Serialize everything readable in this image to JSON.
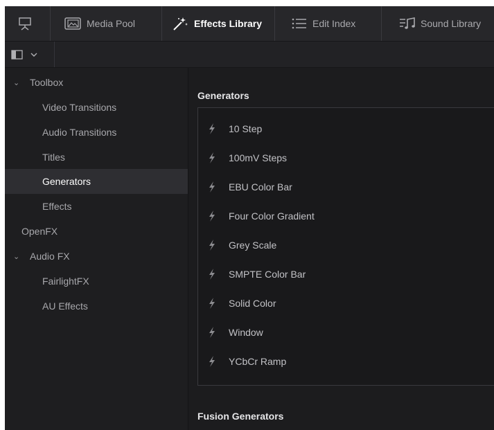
{
  "toolbar": {
    "tabs": [
      {
        "label": "Media Pool",
        "icon": "media-pool-icon"
      },
      {
        "label": "Effects Library",
        "icon": "effects-wand-icon",
        "active": true
      },
      {
        "label": "Edit Index",
        "icon": "list-icon"
      },
      {
        "label": "Sound Library",
        "icon": "music-note-icon"
      }
    ]
  },
  "sidebar": {
    "items": [
      {
        "label": "Toolbox",
        "level": 0,
        "expanded": true
      },
      {
        "label": "Video Transitions",
        "level": 1
      },
      {
        "label": "Audio Transitions",
        "level": 1
      },
      {
        "label": "Titles",
        "level": 1
      },
      {
        "label": "Generators",
        "level": 1,
        "selected": true
      },
      {
        "label": "Effects",
        "level": 1
      },
      {
        "label": "OpenFX",
        "level": 0
      },
      {
        "label": "Audio FX",
        "level": 0,
        "expanded": true
      },
      {
        "label": "FairlightFX",
        "level": 1
      },
      {
        "label": "AU Effects",
        "level": 1
      }
    ]
  },
  "main": {
    "generators_title": "Generators",
    "generators": [
      "10 Step",
      "100mV Steps",
      "EBU Color Bar",
      "Four Color Gradient",
      "Grey Scale",
      "SMPTE Color Bar",
      "Solid Color",
      "Window",
      "YCbCr Ramp"
    ],
    "fusion_title": "Fusion Generators"
  },
  "colors": {
    "background": "#1e1e20",
    "selected_row": "#2e2e32",
    "text": "#c2c2c6"
  }
}
